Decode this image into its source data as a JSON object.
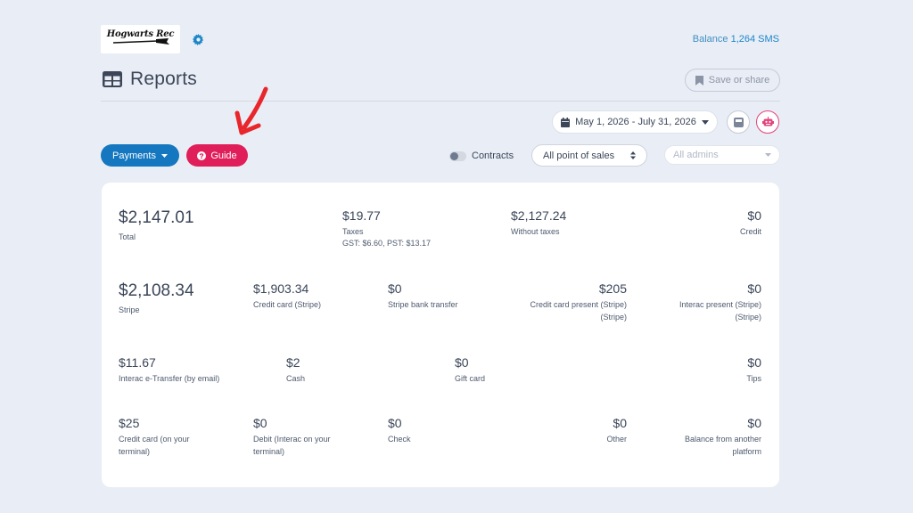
{
  "header": {
    "logo_text": "Hogwarts Rec",
    "balance_label": "Balance",
    "balance_value": "1,264 SMS",
    "page_title": "Reports",
    "save_share_label": "Save or share"
  },
  "toolbar": {
    "date_range": "May 1, 2026 - July 31, 2026",
    "payments_label": "Payments",
    "guide_label": "Guide",
    "contracts_label": "Contracts",
    "pos_select_value": "All point of sales",
    "admins_placeholder": "All admins"
  },
  "colors": {
    "primary": "#1477bf",
    "guide": "#e01e5a",
    "background": "#e9edf5",
    "annotation_arrow": "#e8262c"
  },
  "stats": {
    "total": {
      "amount": "$2,147.01",
      "label": "Total"
    },
    "taxes": {
      "amount": "$19.77",
      "label": "Taxes",
      "detail": "GST: $6.60, PST: $13.17"
    },
    "without_taxes": {
      "amount": "$2,127.24",
      "label": "Without taxes"
    },
    "credit": {
      "amount": "$0",
      "label": "Credit"
    },
    "stripe": {
      "amount": "$2,108.34",
      "label": "Stripe"
    },
    "cc_stripe": {
      "amount": "$1,903.34",
      "label": "Credit card (Stripe)"
    },
    "stripe_bank": {
      "amount": "$0",
      "label": "Stripe bank transfer"
    },
    "cc_present": {
      "amount": "$205",
      "label": "Credit card present (Stripe)",
      "label2": "(Stripe)"
    },
    "interac_present": {
      "amount": "$0",
      "label": "Interac present (Stripe)",
      "label2": "(Stripe)"
    },
    "interac_etransfer": {
      "amount": "$11.67",
      "label": "Interac e-Transfer (by email)"
    },
    "cash": {
      "amount": "$2",
      "label": "Cash"
    },
    "gift_card": {
      "amount": "$0",
      "label": "Gift card"
    },
    "tips": {
      "amount": "$0",
      "label": "Tips"
    },
    "cc_terminal": {
      "amount": "$25",
      "label": "Credit card (on your",
      "label2": "terminal)"
    },
    "debit": {
      "amount": "$0",
      "label": "Debit (Interac on your",
      "label2": "terminal)"
    },
    "check": {
      "amount": "$0",
      "label": "Check"
    },
    "other": {
      "amount": "$0",
      "label": "Other"
    },
    "balance_other": {
      "amount": "$0",
      "label": "Balance from another",
      "label2": "platform"
    }
  }
}
